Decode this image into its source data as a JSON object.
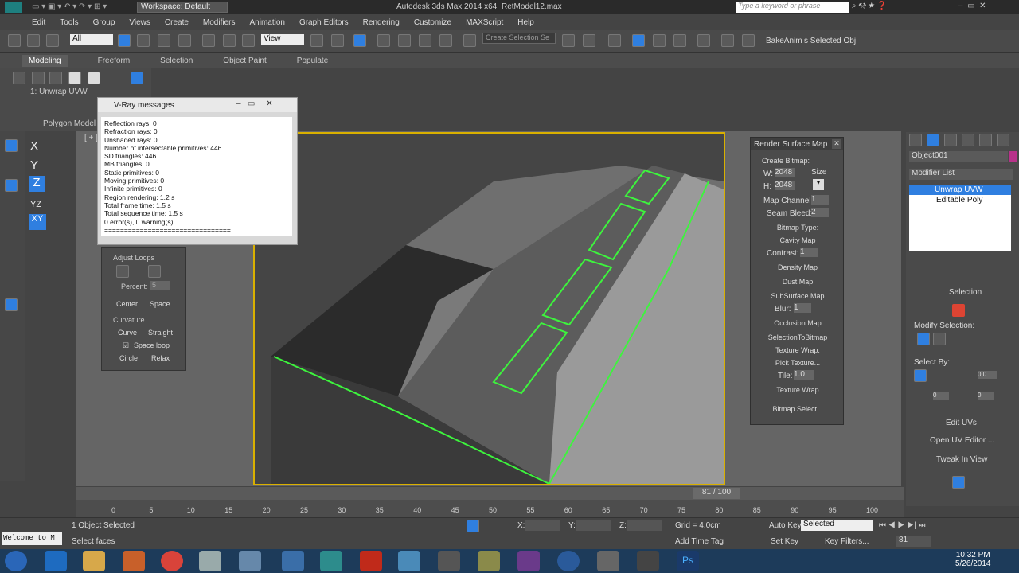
{
  "app": {
    "title": "Autodesk 3ds Max 2014 x64",
    "file": "RetModel12.max",
    "workspace": "Workspace: Default",
    "search_placeholder": "Type a keyword or phrase"
  },
  "menu": [
    "Edit",
    "Tools",
    "Group",
    "Views",
    "Create",
    "Modifiers",
    "Animation",
    "Graph Editors",
    "Rendering",
    "Customize",
    "MAXScript",
    "Help"
  ],
  "toolbar": {
    "filter": "All",
    "view": "View",
    "selection_set": "Create Selection Se",
    "bakeanim": "BakeAnim",
    "selected_obj": "s Selected Obj"
  },
  "ribbon": {
    "tabs": [
      "Modeling",
      "Freeform",
      "Selection",
      "Object Paint",
      "Populate"
    ],
    "active": "Modeling",
    "modifier": "1: Unwrap UVW",
    "polygon_model": "Polygon Model"
  },
  "vray": {
    "title": "V-Ray messages",
    "lines": [
      "Reflection rays: 0",
      "Refraction rays: 0",
      "Unshaded rays: 0",
      "Number of intersectable primitives: 446",
      "SD triangles: 446",
      "MB triangles: 0",
      "Static primitives: 0",
      "Moving primitives: 0",
      "Infinite primitives: 0",
      "Region rendering: 1.2 s",
      "Total frame time: 1.5 s",
      "Total sequence time: 1.5 s",
      "0 error(s), 0 warning(s)",
      "================================"
    ]
  },
  "loops": {
    "title": "Adjust Loops",
    "percent_label": "Percent:",
    "percent": "5",
    "center": "Center",
    "space": "Space",
    "curvature": "Curvature",
    "curve": "Curve",
    "straight": "Straight",
    "space_loop": "Space loop",
    "circle": "Circle",
    "relax": "Relax"
  },
  "axes": [
    "X",
    "Y",
    "Z",
    "YZ",
    "XY"
  ],
  "rsm": {
    "title": "Render Surface Map",
    "create_bitmap": "Create Bitmap:",
    "w_label": "W:",
    "w": "2048",
    "h_label": "H:",
    "h": "2048",
    "size": "Size",
    "map_channel": "Map Channel:",
    "map_channel_val": "1",
    "seam_bleed": "Seam Bleed:",
    "seam_bleed_val": "2",
    "bitmap_type": "Bitmap Type:",
    "cavity": "Cavity Map",
    "contrast": "Contrast:",
    "contrast_val": "1",
    "density": "Density Map",
    "dust": "Dust Map",
    "subsurface": "SubSurface Map",
    "blur": "Blur:",
    "blur_val": "1",
    "occlusion": "Occlusion Map",
    "sel_to_bitmap": "SelectionToBitmap",
    "texture_wrap": "Texture Wrap:",
    "pick_texture": "Pick Texture...",
    "tile": "Tile:",
    "tile_val": "1.0",
    "texture_wrap_btn": "Texture Wrap",
    "bitmap_select": "Bitmap Select..."
  },
  "cmd": {
    "object": "Object001",
    "modifier_list": "Modifier List",
    "stack": [
      "Unwrap UVW",
      "Editable Poly"
    ],
    "selection": "Selection",
    "modify_selection": "Modify Selection:",
    "select_by": "Select By:",
    "v1": "0.0",
    "v2": "0",
    "v3": "0",
    "edit_uvs": "Edit UVs",
    "open_uv": "Open UV Editor ...",
    "tweak": "Tweak In View"
  },
  "timeline": {
    "frame": "81 / 100",
    "ticks": [
      "0",
      "5",
      "10",
      "15",
      "20",
      "25",
      "30",
      "35",
      "40",
      "45",
      "50",
      "55",
      "60",
      "65",
      "70",
      "75",
      "80",
      "85",
      "90",
      "95",
      "100"
    ],
    "current": 81
  },
  "status": {
    "welcome": "Welcome to M",
    "objects": "1 Object Selected",
    "prompt": "Select faces",
    "x": "X:",
    "y": "Y:",
    "z": "Z:",
    "grid": "Grid = 4.0cm",
    "auto_key": "Auto Key",
    "selected": "Selected",
    "set_key": "Set Key",
    "key_filters": "Key Filters...",
    "add_time_tag": "Add Time Tag",
    "frame_field": "81"
  },
  "taskbar": {
    "time": "10:32 PM",
    "date": "5/26/2014"
  },
  "colors": {
    "accent_blue": "#2f7fe0",
    "selection_green": "#3df43d",
    "viewport_border": "#d9b000"
  }
}
